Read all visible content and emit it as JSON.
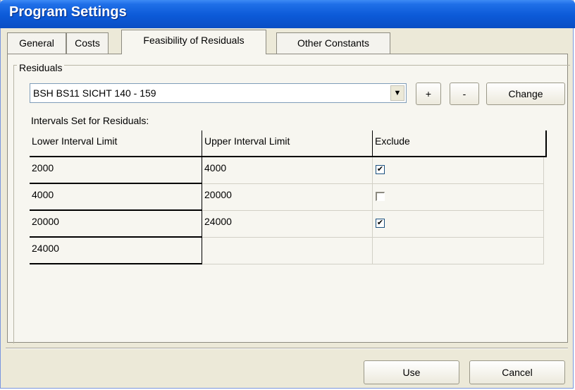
{
  "window": {
    "title": "Program Settings"
  },
  "tabs": [
    {
      "label": "General"
    },
    {
      "label": "Costs"
    },
    {
      "label": "Feasibility of Residuals"
    },
    {
      "label": "Other Constants"
    }
  ],
  "residuals": {
    "group_label": "Residuals",
    "selected": "BSH BS11 SICHT 140 - 159",
    "plus_label": "+",
    "minus_label": "-",
    "change_label": "Change",
    "intervals_caption": "Intervals Set for Residuals:"
  },
  "grid": {
    "headers": [
      "Lower Interval Limit",
      "Upper Interval Limit",
      "Exclude"
    ],
    "rows": [
      {
        "lower": "2000",
        "upper": "4000",
        "exclude": true
      },
      {
        "lower": "4000",
        "upper": "20000",
        "exclude": false
      },
      {
        "lower": "20000",
        "upper": "24000",
        "exclude": true
      },
      {
        "lower": "24000",
        "upper": "",
        "exclude": null
      }
    ]
  },
  "footer": {
    "use_label": "Use",
    "cancel_label": "Cancel"
  }
}
